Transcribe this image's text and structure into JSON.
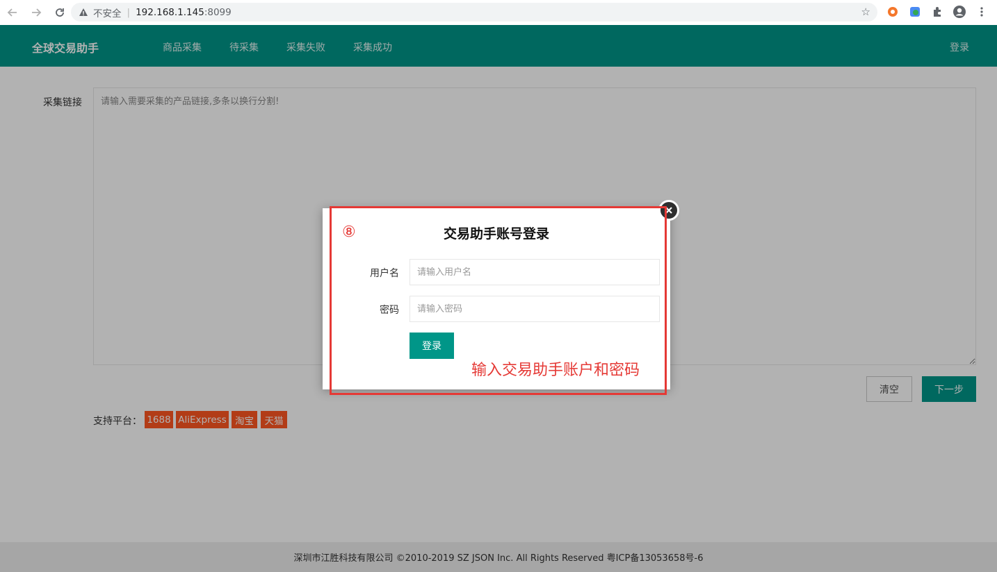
{
  "browser": {
    "insecure_label": "不安全",
    "url_host": "192.168.1.145",
    "url_port": ":8099"
  },
  "header": {
    "brand": "全球交易助手",
    "menu": [
      {
        "label": "商品采集"
      },
      {
        "label": "待采集"
      },
      {
        "label": "采集失败"
      },
      {
        "label": "采集成功"
      }
    ],
    "login": "登录"
  },
  "form": {
    "links_label": "采集链接",
    "links_placeholder": "请输入需要采集的产品链接,多条以换行分割!",
    "clear_button": "清空",
    "next_button": "下一步",
    "platforms_label": "支持平台：",
    "platforms": [
      "1688",
      "AliExpress",
      "淘宝",
      "天猫"
    ]
  },
  "footer": {
    "text": "深圳市江胜科技有限公司 ©2010-2019 SZ JSON Inc. All Rights Reserved 粤ICP备13053658号-6"
  },
  "modal": {
    "title": "交易助手账号登录",
    "username_label": "用户名",
    "username_placeholder": "请输入用户名",
    "password_label": "密码",
    "password_placeholder": "请输入密码",
    "login_button": "登录"
  },
  "annotation": {
    "step": "⑧",
    "note": "输入交易助手账户和密码",
    "color": "#e53935"
  },
  "colors": {
    "primary": "#009688",
    "tag": "#ff5722"
  }
}
